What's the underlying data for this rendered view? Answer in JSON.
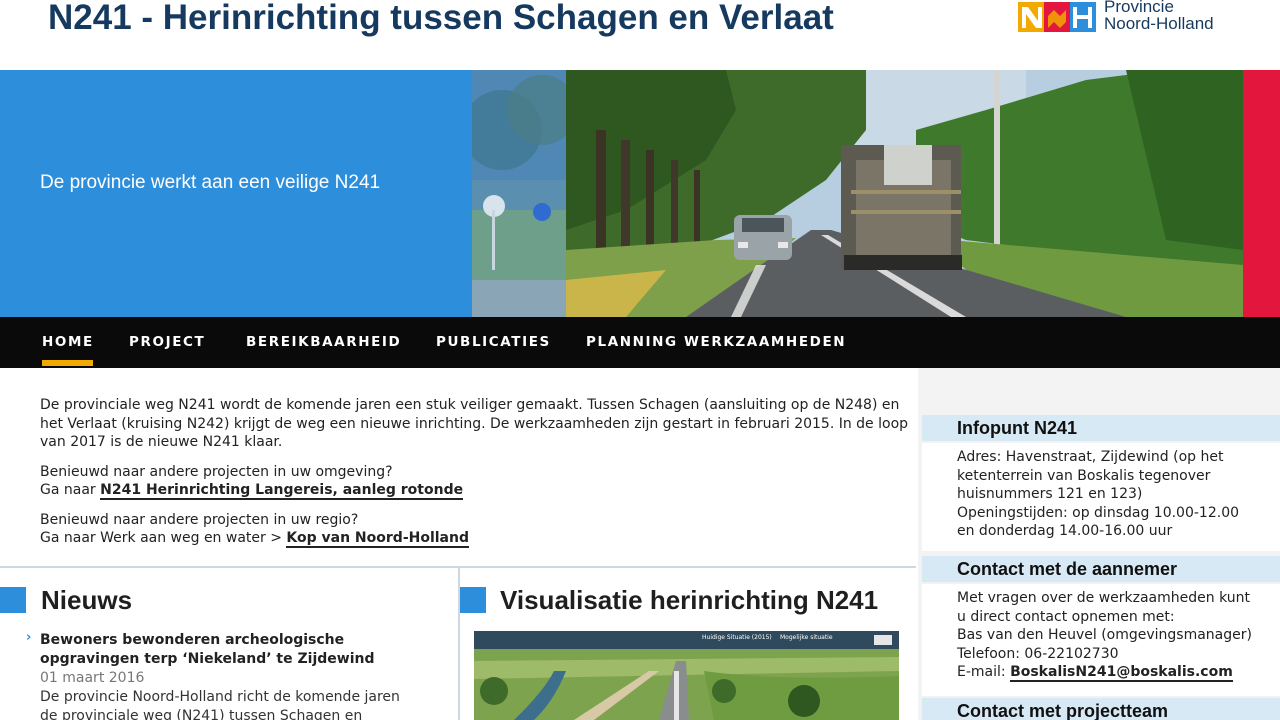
{
  "header": {
    "title": "N241 - Herinrichting tussen Schagen en Verlaat",
    "logo": {
      "line1": "Provincie",
      "line2": "Noord-Holland",
      "icon": "provincie-noord-holland-logo"
    }
  },
  "banner": {
    "tagline": "De provincie werkt aan een veilige N241",
    "colors": {
      "blue": "#2d8fdc",
      "red": "#e3173e"
    }
  },
  "nav": {
    "items": [
      {
        "label": "HOME",
        "active": true
      },
      {
        "label": "PROJECT"
      },
      {
        "label": "BEREIKBAARHEID"
      },
      {
        "label": "PUBLICATIES"
      },
      {
        "label": "PLANNING WERKZAAMHEDEN"
      }
    ],
    "active_color": "#f2a900"
  },
  "intro": {
    "paragraph": "De provinciale weg N241 wordt de komende jaren een stuk veiliger gemaakt. Tussen Schagen (aansluiting op de N248) en het Verlaat (kruising N242) krijgt de weg een nieuwe inrichting. De werkzaamheden zijn gestart in februari 2015. In de loop van 2017 is de nieuwe N241 klaar.",
    "block1_line1": "Benieuwd naar andere projecten in uw omgeving?",
    "block1_prefix": "Ga naar ",
    "block1_link": "N241 Herinrichting Langereis, aanleg rotonde",
    "block2_line1": "Benieuwd naar andere projecten in uw regio?",
    "block2_prefix": "Ga naar Werk aan weg en water > ",
    "block2_link": "Kop van Noord-Holland"
  },
  "sidebar": {
    "infopunt": {
      "heading": "Infopunt N241",
      "line1": "Adres: Havenstraat, Zijdewind (op het",
      "line2": "ketenterrein van Boskalis tegenover",
      "line3": "huisnummers 121 en 123)",
      "line4": "Openingstijden: op dinsdag 10.00-12.00",
      "line5": "en donderdag 14.00-16.00 uur"
    },
    "aannemer": {
      "heading": "Contact met de aannemer",
      "line1": "Met vragen over de werkzaamheden kunt",
      "line2": "u direct contact opnemen met:",
      "line3": "Bas van den Heuvel (omgevingsmanager)",
      "line4": "Telefoon: 06-22102730",
      "email_prefix": "E-mail: ",
      "email": "BoskalisN241@boskalis.com"
    },
    "projectteam": {
      "heading": "Contact met projectteam"
    }
  },
  "news": {
    "heading": "Nieuws",
    "item": {
      "title_line1": "Bewoners bewonderen archeologische",
      "title_line2": "opgravingen terp ‘Niekeland’ te Zijdewind",
      "date": "01 maart 2016",
      "text_line1": "De provincie Noord-Holland richt de komende jaren",
      "text_line2": "de provinciale weg (N241) tussen Schagen en"
    }
  },
  "visualisatie": {
    "heading": "Visualisatie herinrichting N241",
    "label_left": "Huidige Situatie (2015)",
    "label_right": "Mogelijke situatie"
  }
}
